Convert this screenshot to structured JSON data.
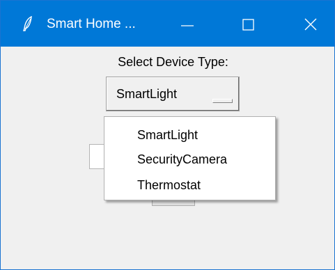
{
  "window": {
    "title": "Smart Home ...",
    "icon": "feather-icon",
    "controls": [
      "minimize-icon",
      "maximize-icon",
      "close-icon"
    ]
  },
  "form": {
    "device_type_label": "Select Device Type:",
    "device_type_selected": "SmartLight",
    "name_entry_value": ""
  },
  "dropdown": {
    "options": [
      "SmartLight",
      "SecurityCamera",
      "Thermostat"
    ]
  },
  "colors": {
    "titlebar": "#0078d7",
    "client_bg": "#f0f0f0"
  }
}
